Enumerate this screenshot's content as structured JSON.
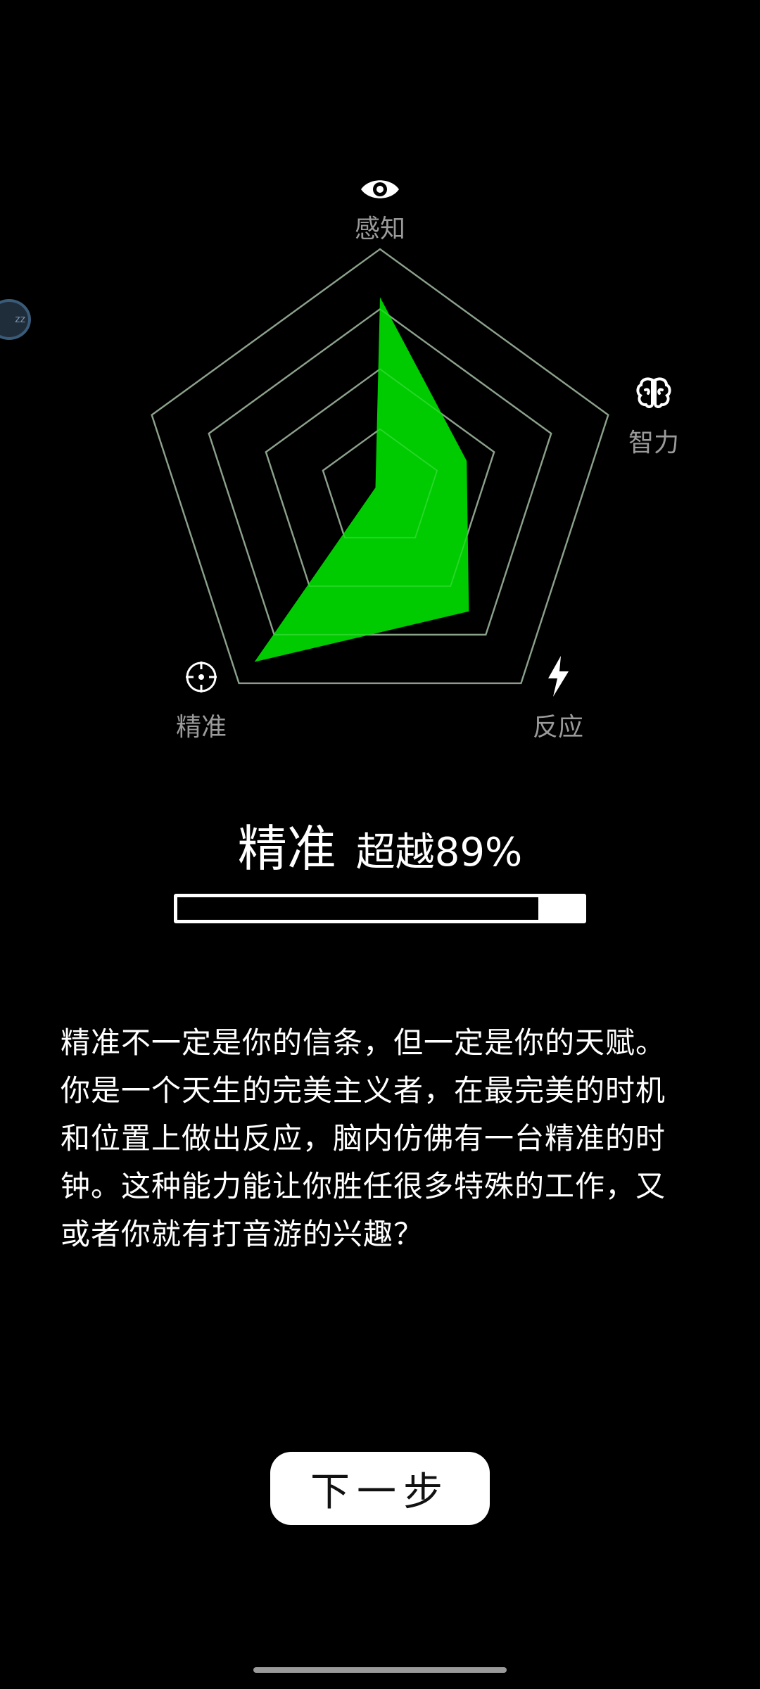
{
  "radar": {
    "levels": 4,
    "max": 1.0,
    "axes": [
      {
        "label": "感知",
        "icon": "eye-icon",
        "value": 0.8
      },
      {
        "label": "智力",
        "icon": "brain-icon",
        "value": 0.38
      },
      {
        "label": "反应",
        "icon": "lightning-icon",
        "value": 0.63
      },
      {
        "label": "精准",
        "icon": "crosshair-icon",
        "value": 0.89
      },
      {
        "label": "",
        "icon": "",
        "value": 0.02
      }
    ],
    "fill_color": "#00d600",
    "grid_color": "#8c8c8c"
  },
  "result": {
    "trait": "精准",
    "percent_text": "超越89%",
    "progress": 0.89
  },
  "description": "精准不一定是你的信条，但一定是你的天赋。你是一个天生的完美主义者，在最完美的时机和位置上做出反应，脑内仿佛有一台精准的时钟。这种能力能让你胜任很多特殊的工作，又或者你就有打音游的兴趣？",
  "next_button_label": "下一步",
  "floating_bubble_text": "zz"
}
